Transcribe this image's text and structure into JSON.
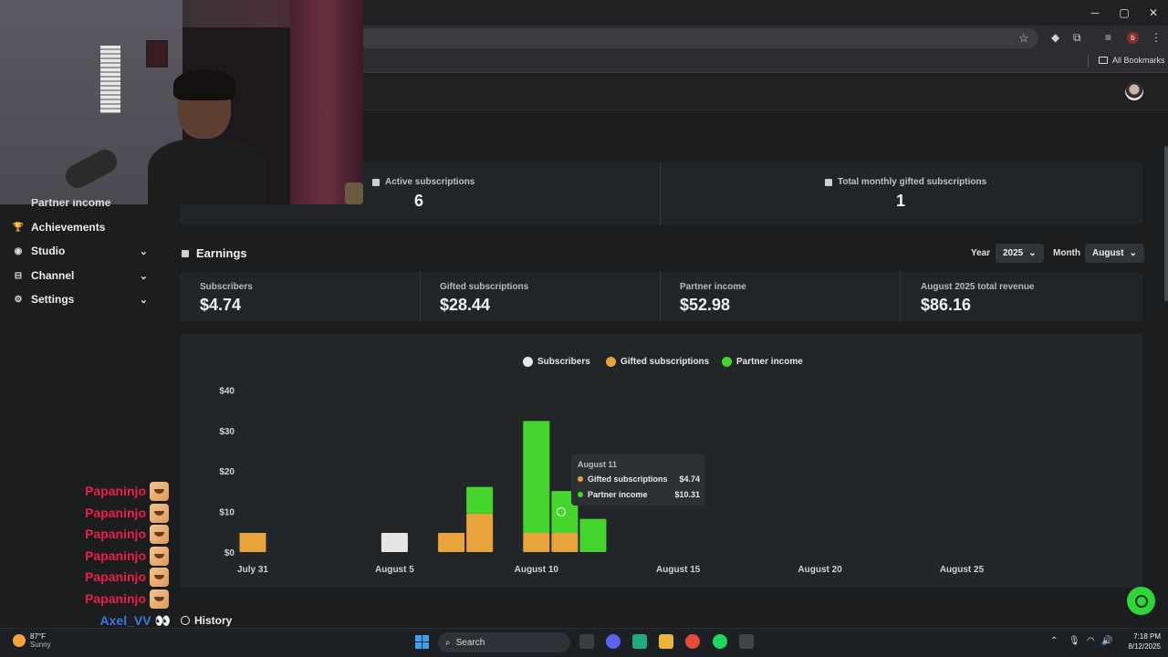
{
  "browser": {
    "window_controls": [
      "─",
      "▢",
      "✕"
    ],
    "all_bookmarks": "All Bookmarks",
    "profile_letter": "b"
  },
  "sidebar": {
    "cut_item": "Partner income",
    "items": [
      {
        "label": "Achievements",
        "icon": "trophy-icon",
        "glyph": "🏆",
        "chevron": ""
      },
      {
        "label": "Studio",
        "icon": "studio-icon",
        "glyph": "◉",
        "chevron": "⌄"
      },
      {
        "label": "Channel",
        "icon": "channel-icon",
        "glyph": "⊟",
        "chevron": "⌄"
      },
      {
        "label": "Settings",
        "icon": "gear-icon",
        "glyph": "⚙",
        "chevron": "⌄"
      }
    ]
  },
  "chat": {
    "lines": [
      "Papaninjo",
      "Papaninjo",
      "Papaninjo",
      "Papaninjo",
      "Papaninjo",
      "Papaninjo"
    ],
    "last": "Axel_VV"
  },
  "summary": {
    "active_label": "Active subscriptions",
    "active_value": "6",
    "gifted_label": "Total monthly gifted subscriptions",
    "gifted_value": "1"
  },
  "earnings": {
    "title": "Earnings",
    "year_label": "Year",
    "year_value": "2025",
    "month_label": "Month",
    "month_value": "August",
    "cards": [
      {
        "label": "Subscribers",
        "value": "$4.74"
      },
      {
        "label": "Gifted subscriptions",
        "value": "$28.44"
      },
      {
        "label": "Partner income",
        "value": "$52.98"
      },
      {
        "label": "August 2025 total revenue",
        "value": "$86.16"
      }
    ]
  },
  "chart_data": {
    "type": "bar",
    "stacked": true,
    "legend": [
      {
        "name": "Subscribers",
        "color": "#e6e6e6"
      },
      {
        "name": "Gifted subscriptions",
        "color": "#e8a33a"
      },
      {
        "name": "Partner income",
        "color": "#44d62c"
      }
    ],
    "y_ticks": [
      "$0",
      "$10",
      "$20",
      "$30",
      "$40"
    ],
    "ylim": [
      0,
      40
    ],
    "x_ticks": [
      "July 31",
      "August 5",
      "August 10",
      "August 15",
      "August 20",
      "August 25"
    ],
    "x_range": [
      "July 31",
      "August 26"
    ],
    "bars": [
      {
        "date": "July 31",
        "subscribers": 0,
        "gifted": 4.74,
        "partner": 0
      },
      {
        "date": "August 5",
        "subscribers": 4.74,
        "gifted": 0,
        "partner": 0
      },
      {
        "date": "August 7",
        "subscribers": 0,
        "gifted": 4.74,
        "partner": 0
      },
      {
        "date": "August 8",
        "subscribers": 0,
        "gifted": 9.48,
        "partner": 6.6
      },
      {
        "date": "August 10",
        "subscribers": 0,
        "gifted": 4.74,
        "partner": 27.6
      },
      {
        "date": "August 11",
        "subscribers": 0,
        "gifted": 4.74,
        "partner": 10.31
      },
      {
        "date": "August 12",
        "subscribers": 0,
        "gifted": 0,
        "partner": 8.2
      }
    ],
    "tooltip": {
      "date": "August 11",
      "rows": [
        {
          "name": "Gifted subscriptions",
          "value": "$4.74",
          "color": "#e8a33a"
        },
        {
          "name": "Partner income",
          "value": "$10.31",
          "color": "#44d62c"
        }
      ]
    }
  },
  "history": "History",
  "taskbar": {
    "temp": "87°F",
    "condition": "Sunny",
    "search": "Search",
    "time": "7:18 PM",
    "date": "8/12/2025"
  }
}
